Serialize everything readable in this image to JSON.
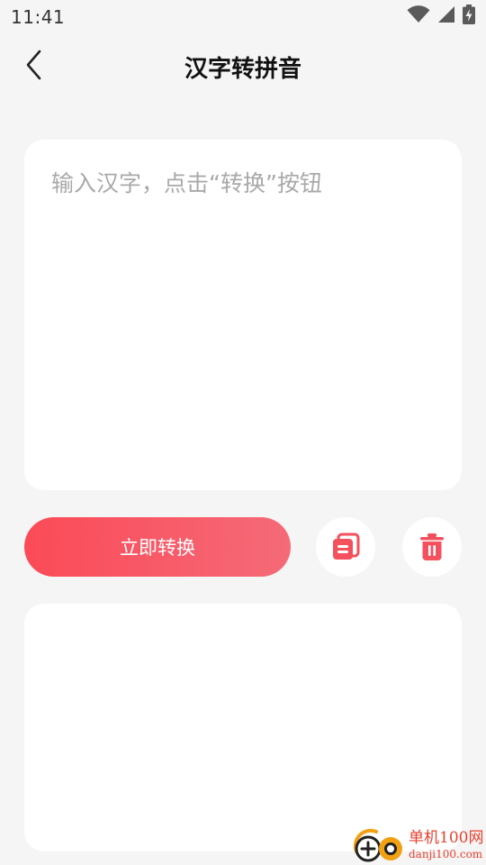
{
  "status_bar": {
    "time": "11:41",
    "icons": [
      "wifi-icon",
      "signal-icon",
      "battery-icon"
    ]
  },
  "nav": {
    "back_icon": "chevron-left-icon",
    "title": "汉字转拼音"
  },
  "input": {
    "value": "",
    "placeholder": "输入汉字，点击“转换”按钮"
  },
  "actions": {
    "convert_label": "立即转换",
    "copy_icon": "copy-icon",
    "delete_icon": "trash-icon"
  },
  "output": {
    "value": ""
  },
  "watermark": {
    "name": "单机100网",
    "url": "danji100.com"
  },
  "colors": {
    "accent_start": "#fb4a57",
    "accent_end": "#f56a78",
    "background": "#f5f5f5",
    "card": "#ffffff"
  }
}
